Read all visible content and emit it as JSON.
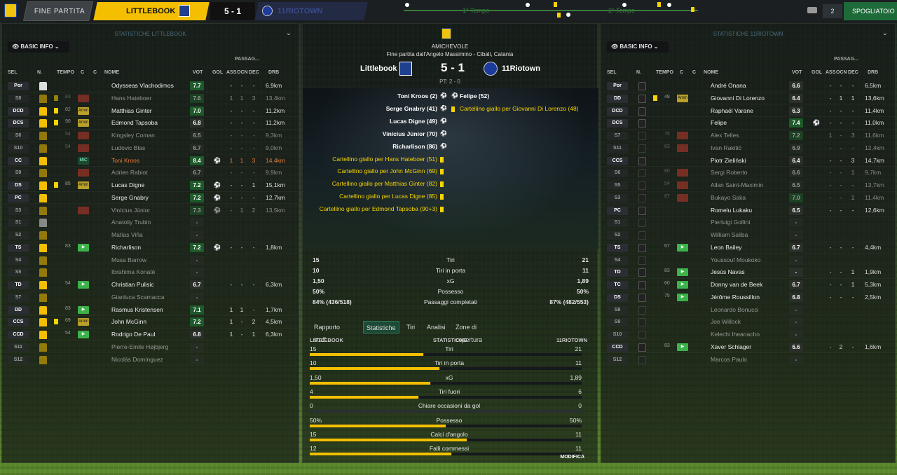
{
  "topbar": {
    "fine": "FINE PARTITA",
    "home": "LITTLEBOOK",
    "score": "5 - 1",
    "away": "11RIOTOWN",
    "tempo1": "1° Tempo",
    "tempo2": "2° Tempo",
    "users": "2",
    "spogliatoio": "SPOGLIATOIO"
  },
  "left": {
    "title": "STATISTICHE LITTLEBOOK",
    "basic": "BASIC INFO",
    "passag": "PASSAG...",
    "headers": [
      "SEL",
      "N.",
      "TEMPO",
      "C",
      "C",
      "NOME",
      "VOT",
      "GOL",
      "ASS",
      "OCN",
      "DEC",
      "DRB"
    ],
    "rows": [
      {
        "pos": "Por",
        "shirt": "w",
        "yc": false,
        "min": "",
        "pm": "",
        "name": "Odysseas Vlachodimos",
        "vot": "7.7",
        "gol": "",
        "ass": "-",
        "ocn": "-",
        "dec": "-",
        "drb": "6,9km",
        "dim": false
      },
      {
        "pos": "S8",
        "shirt": "y",
        "yc": true,
        "min": "83",
        "pm": "red",
        "pmt": "",
        "name": "Hans Hateboer",
        "vot": "7.6",
        "gol": "",
        "ass": "1",
        "ocn": "1",
        "dec": "3",
        "drb": "13,4km",
        "dim": true
      },
      {
        "pos": "DCD",
        "shirt": "y",
        "yc": true,
        "min": "82",
        "pm": "amm",
        "pmt": "Amm",
        "name": "Matthias Ginter",
        "vot": "7.0",
        "gol": "",
        "ass": "-",
        "ocn": "-",
        "dec": "-",
        "drb": "11,2km",
        "dim": false
      },
      {
        "pos": "DCS",
        "shirt": "y",
        "yc": true,
        "min": "90",
        "pm": "amm",
        "pmt": "Amm",
        "name": "Edmond Tapsoba",
        "vot": "6.8",
        "gol": "",
        "ass": "-",
        "ocn": "-",
        "dec": "-",
        "drb": "11,2km",
        "dim": false
      },
      {
        "pos": "S6",
        "shirt": "y",
        "yc": false,
        "min": "54",
        "pm": "red",
        "pmt": "",
        "name": "Kingsley Coman",
        "vot": "6.5",
        "gol": "",
        "ass": "-",
        "ocn": "-",
        "dec": "-",
        "drb": "9,3km",
        "dim": true
      },
      {
        "pos": "S10",
        "shirt": "y",
        "yc": false,
        "min": "54",
        "pm": "red",
        "pmt": "",
        "name": "Ludovic Blas",
        "vot": "6.7",
        "gol": "",
        "ass": "-",
        "ocn": "-",
        "dec": "-",
        "drb": "9,0km",
        "dim": true
      },
      {
        "pos": "CC",
        "shirt": "y",
        "yc": false,
        "min": "",
        "pm": "mic",
        "pmt": "MiC",
        "name": "Toni Kroos",
        "vot": "8.4",
        "gol": "⚽",
        "ass": "1",
        "ocn": "1",
        "dec": "3",
        "drb": "14,4km",
        "dim": false,
        "hl": true
      },
      {
        "pos": "S9",
        "shirt": "y",
        "yc": false,
        "min": "",
        "pm": "red",
        "pmt": "",
        "name": "Adrien Rabiot",
        "vot": "6.7",
        "gol": "",
        "ass": "-",
        "ocn": "-",
        "dec": "-",
        "drb": "9,9km",
        "dim": true
      },
      {
        "pos": "DS",
        "shirt": "y",
        "yc": true,
        "min": "85",
        "pm": "amm",
        "pmt": "Amm",
        "name": "Lucas Digne",
        "vot": "7.2",
        "gol": "⚽",
        "ass": "-",
        "ocn": "-",
        "dec": "1",
        "drb": "15,1km",
        "dim": false
      },
      {
        "pos": "PC",
        "shirt": "y",
        "yc": false,
        "min": "",
        "pm": "",
        "pmt": "",
        "name": "Serge Gnabry",
        "vot": "7.2",
        "gol": "⚽",
        "ass": "-",
        "ocn": "-",
        "dec": "-",
        "drb": "12,7km",
        "dim": false
      },
      {
        "pos": "S3",
        "shirt": "y",
        "yc": false,
        "min": "",
        "pm": "red",
        "pmt": "",
        "name": "Vinícius Júnior",
        "vot": "7.3",
        "gol": "⚽",
        "ass": "-",
        "ocn": "1",
        "dec": "2",
        "drb": "13,5km",
        "dim": true
      },
      {
        "pos": "S1",
        "shirt": "w",
        "yc": false,
        "min": "",
        "pm": "",
        "pmt": "",
        "name": "Anatoliy Trubin",
        "vot": "-",
        "gol": "",
        "ass": "",
        "ocn": "",
        "dec": "",
        "drb": "",
        "dim": true
      },
      {
        "pos": "S2",
        "shirt": "y",
        "yc": false,
        "min": "",
        "pm": "",
        "pmt": "",
        "name": "Matías Viña",
        "vot": "-",
        "gol": "",
        "ass": "",
        "ocn": "",
        "dec": "",
        "drb": "",
        "dim": true
      },
      {
        "pos": "TS",
        "shirt": "y",
        "yc": false,
        "min": "83",
        "pm": "grn",
        "pmt": "▶",
        "name": "Richarlison",
        "vot": "7.2",
        "gol": "⚽",
        "ass": "-",
        "ocn": "-",
        "dec": "-",
        "drb": "1,8km",
        "dim": false
      },
      {
        "pos": "S4",
        "shirt": "y",
        "yc": false,
        "min": "",
        "pm": "",
        "pmt": "",
        "name": "Musa Barrow",
        "vot": "-",
        "gol": "",
        "ass": "",
        "ocn": "",
        "dec": "",
        "drb": "",
        "dim": true
      },
      {
        "pos": "S5",
        "shirt": "y",
        "yc": false,
        "min": "",
        "pm": "",
        "pmt": "",
        "name": "Ibrahima Konaté",
        "vot": "-",
        "gol": "",
        "ass": "",
        "ocn": "",
        "dec": "",
        "drb": "",
        "dim": true
      },
      {
        "pos": "TD",
        "shirt": "y",
        "yc": false,
        "min": "54",
        "pm": "grn",
        "pmt": "▶",
        "name": "Christian Pulisic",
        "vot": "6.7",
        "gol": "",
        "ass": "-",
        "ocn": "-",
        "dec": "-",
        "drb": "6,3km",
        "dim": false
      },
      {
        "pos": "S7",
        "shirt": "y",
        "yc": false,
        "min": "",
        "pm": "",
        "pmt": "",
        "name": "Gianluca Scamacca",
        "vot": "-",
        "gol": "",
        "ass": "",
        "ocn": "",
        "dec": "",
        "drb": "",
        "dim": true
      },
      {
        "pos": "DD",
        "shirt": "y",
        "yc": false,
        "min": "83",
        "pm": "grn",
        "pmt": "▶",
        "name": "Rasmus Kristensen",
        "vot": "7.1",
        "gol": "",
        "ass": "1",
        "ocn": "1",
        "dec": "-",
        "drb": "1,7km",
        "dim": false
      },
      {
        "pos": "CCS",
        "shirt": "y",
        "yc": true,
        "min": "69",
        "pm": "amm",
        "pmt": "Amm",
        "name": "John McGinn",
        "vot": "7.2",
        "gol": "",
        "ass": "1",
        "ocn": "-",
        "dec": "2",
        "drb": "4,5km",
        "dim": false
      },
      {
        "pos": "CCD",
        "shirt": "y",
        "yc": false,
        "min": "54",
        "pm": "grn",
        "pmt": "▶",
        "name": "Rodrigo De Paul",
        "vot": "6.8",
        "gol": "",
        "ass": "1",
        "ocn": "-",
        "dec": "1",
        "drb": "6,3km",
        "dim": false
      },
      {
        "pos": "S11",
        "shirt": "y",
        "yc": false,
        "min": "",
        "pm": "",
        "pmt": "",
        "name": "Pierre-Emile Højbjerg",
        "vot": "-",
        "gol": "",
        "ass": "",
        "ocn": "",
        "dec": "",
        "drb": "",
        "dim": true
      },
      {
        "pos": "S12",
        "shirt": "y",
        "yc": false,
        "min": "",
        "pm": "",
        "pmt": "",
        "name": "Nicolás Domínguez",
        "vot": "-",
        "gol": "",
        "ass": "",
        "ocn": "",
        "dec": "",
        "drb": "",
        "dim": true
      }
    ]
  },
  "right": {
    "title": "STATISTICHE 11RIOTOWN",
    "basic": "BASIC INFO",
    "passag": "PASSAG...",
    "headers": [
      "SEL",
      "N.",
      "TEMPO",
      "C",
      "C",
      "NOME",
      "VOT",
      "GOL",
      "ASS",
      "OCN",
      "DEC",
      "DRB"
    ],
    "rows": [
      {
        "pos": "Por",
        "yc": false,
        "min": "",
        "pm": "",
        "pmt": "",
        "name": "André Onana",
        "vot": "6.6",
        "gol": "",
        "ass": "-",
        "ocn": "-",
        "dec": "-",
        "drb": "6,5km",
        "dim": false
      },
      {
        "pos": "DD",
        "yc": true,
        "min": "48",
        "pm": "amm",
        "pmt": "Amm",
        "name": "Giovanni Di Lorenzo",
        "vot": "6.4",
        "gol": "",
        "ass": "-",
        "ocn": "1",
        "dec": "1",
        "drb": "13,6km",
        "dim": false
      },
      {
        "pos": "DCD",
        "yc": false,
        "min": "",
        "pm": "",
        "pmt": "",
        "name": "Raphaël Varane",
        "vot": "6.3",
        "gol": "",
        "ass": "-",
        "ocn": "-",
        "dec": "-",
        "drb": "11,4km",
        "dim": false
      },
      {
        "pos": "DCS",
        "yc": false,
        "min": "",
        "pm": "",
        "pmt": "",
        "name": "Felipe",
        "vot": "7.4",
        "gol": "⚽",
        "ass": "-",
        "ocn": "-",
        "dec": "-",
        "drb": "11,0km",
        "dim": false
      },
      {
        "pos": "S7",
        "yc": false,
        "min": "75",
        "pm": "red",
        "pmt": "",
        "name": "Alex Telles",
        "vot": "7.2",
        "gol": "",
        "ass": "1",
        "ocn": "-",
        "dec": "3",
        "drb": "11,6km",
        "dim": true
      },
      {
        "pos": "S11",
        "yc": false,
        "min": "83",
        "pm": "red",
        "pmt": "",
        "name": "Ivan Rakitić",
        "vot": "6.9",
        "gol": "",
        "ass": "-",
        "ocn": "-",
        "dec": "-",
        "drb": "12,4km",
        "dim": true
      },
      {
        "pos": "CCS",
        "yc": false,
        "min": "",
        "pm": "",
        "pmt": "",
        "name": "Piotr Zieliński",
        "vot": "6.4",
        "gol": "",
        "ass": "-",
        "ocn": "-",
        "dec": "3",
        "drb": "14,7km",
        "dim": false
      },
      {
        "pos": "S6",
        "yc": false,
        "min": "60",
        "pm": "red",
        "pmt": "",
        "name": "Sergi Roberto",
        "vot": "6.6",
        "gol": "",
        "ass": "-",
        "ocn": "-",
        "dec": "1",
        "drb": "9,7km",
        "dim": true
      },
      {
        "pos": "S5",
        "yc": false,
        "min": "54",
        "pm": "red",
        "pmt": "",
        "name": "Allan Saint-Maximin",
        "vot": "6.5",
        "gol": "",
        "ass": "-",
        "ocn": "-",
        "dec": "-",
        "drb": "13,7km",
        "dim": true
      },
      {
        "pos": "S3",
        "yc": false,
        "min": "67",
        "pm": "red",
        "pmt": "",
        "name": "Bukayo Saka",
        "vot": "7.0",
        "gol": "",
        "ass": "-",
        "ocn": "-",
        "dec": "1",
        "drb": "11,4km",
        "dim": true
      },
      {
        "pos": "PC",
        "yc": false,
        "min": "",
        "pm": "",
        "pmt": "",
        "name": "Romelu Lukaku",
        "vot": "6.5",
        "gol": "",
        "ass": "-",
        "ocn": "-",
        "dec": "-",
        "drb": "12,6km",
        "dim": false
      },
      {
        "pos": "S1",
        "yc": false,
        "min": "",
        "pm": "",
        "pmt": "",
        "name": "Pierluigi Gollini",
        "vot": "-",
        "gol": "",
        "ass": "",
        "ocn": "",
        "dec": "",
        "drb": "",
        "dim": true
      },
      {
        "pos": "S2",
        "yc": false,
        "min": "",
        "pm": "",
        "pmt": "",
        "name": "William Saliba",
        "vot": "-",
        "gol": "",
        "ass": "",
        "ocn": "",
        "dec": "",
        "drb": "",
        "dim": true
      },
      {
        "pos": "TS",
        "yc": false,
        "min": "67",
        "pm": "grn",
        "pmt": "▶",
        "name": "Leon Bailey",
        "vot": "6.7",
        "gol": "",
        "ass": "-",
        "ocn": "-",
        "dec": "-",
        "drb": "4,4km",
        "dim": false
      },
      {
        "pos": "S4",
        "yc": false,
        "min": "",
        "pm": "",
        "pmt": "",
        "name": "Youssouf Moukoko",
        "vot": "-",
        "gol": "",
        "ass": "",
        "ocn": "",
        "dec": "",
        "drb": "",
        "dim": true
      },
      {
        "pos": "TD",
        "yc": false,
        "min": "83",
        "pm": "grn",
        "pmt": "▶",
        "name": "Jesús Navas",
        "vot": "-",
        "gol": "",
        "ass": "-",
        "ocn": "-",
        "dec": "1",
        "drb": "1,9km",
        "dim": false
      },
      {
        "pos": "TC",
        "yc": false,
        "min": "60",
        "pm": "grn",
        "pmt": "▶",
        "name": "Donny van de Beek",
        "vot": "6.7",
        "gol": "",
        "ass": "-",
        "ocn": "-",
        "dec": "1",
        "drb": "5,3km",
        "dim": false
      },
      {
        "pos": "DS",
        "yc": false,
        "min": "75",
        "pm": "grn",
        "pmt": "▶",
        "name": "Jérôme Roussillon",
        "vot": "6.8",
        "gol": "",
        "ass": "-",
        "ocn": "-",
        "dec": "-",
        "drb": "2,5km",
        "dim": false
      },
      {
        "pos": "S8",
        "yc": false,
        "min": "",
        "pm": "",
        "pmt": "",
        "name": "Leonardo Bonucci",
        "vot": "-",
        "gol": "",
        "ass": "",
        "ocn": "",
        "dec": "",
        "drb": "",
        "dim": true
      },
      {
        "pos": "S9",
        "yc": false,
        "min": "",
        "pm": "",
        "pmt": "",
        "name": "Joe Willock",
        "vot": "-",
        "gol": "",
        "ass": "",
        "ocn": "",
        "dec": "",
        "drb": "",
        "dim": true
      },
      {
        "pos": "S10",
        "yc": false,
        "min": "",
        "pm": "",
        "pmt": "",
        "name": "Kelechi Iheanacho",
        "vot": "-",
        "gol": "",
        "ass": "",
        "ocn": "",
        "dec": "",
        "drb": "",
        "dim": true
      },
      {
        "pos": "CCD",
        "yc": false,
        "min": "83",
        "pm": "grn",
        "pmt": "▶",
        "name": "Xaver Schlager",
        "vot": "6.6",
        "gol": "",
        "ass": "-",
        "ocn": "2",
        "dec": "-",
        "drb": "1,6km",
        "dim": false
      },
      {
        "pos": "S12",
        "yc": false,
        "min": "",
        "pm": "",
        "pmt": "",
        "name": "Marcos Paulo",
        "vot": "-",
        "gol": "",
        "ass": "",
        "ocn": "",
        "dec": "",
        "drb": "",
        "dim": true
      }
    ]
  },
  "center": {
    "comp": "AMICHEVOLE",
    "venue": "Fine partita dall'Angelo Massimino - Cibali, Catania",
    "home": "Littlebook",
    "away": "11Riotown",
    "score": "5 - 1",
    "pt": "PT: 2 - 0",
    "home_events": [
      "Toni Kroos (2)",
      "Serge Gnabry (41)",
      "Lucas Digne (49)",
      "Vinícius Júnior (70)",
      "Richarlison (86)",
      "Cartellino giallo per Hans Hateboer (51)",
      "Cartellino giallo per John McGinn (69)",
      "Cartellino giallo per Matthias Ginter (82)",
      "Cartellino giallo per Lucas Digne (85)",
      "Cartellino giallo per Edmond Tapsoba (90+3)"
    ],
    "away_events": [
      "Felipe (52)",
      "Cartellino giallo per Giovanni Di Lorenzo (48)"
    ],
    "summary": [
      [
        "15",
        "Tiri",
        "21"
      ],
      [
        "10",
        "Tiri in porta",
        "11"
      ],
      [
        "1,50",
        "xG",
        "1,89"
      ],
      [
        "50%",
        "Possesso",
        "50%"
      ],
      [
        "84% (436/518)",
        "Passaggi completati",
        "87% (482/553)"
      ]
    ],
    "tabs": [
      "Rapporto staff",
      "Statistiche",
      "Tiri",
      "Analisi",
      "Zone di copertura"
    ],
    "bars_head": [
      "LITTLEBOOK",
      "STATISTICHE",
      "11RIOTOWN"
    ],
    "bars": [
      {
        "h": "15",
        "l": "Tiri",
        "a": "21",
        "hv": 15,
        "av": 21
      },
      {
        "h": "10",
        "l": "Tiri in porta",
        "a": "11",
        "hv": 10,
        "av": 11
      },
      {
        "h": "1,50",
        "l": "xG",
        "a": "1,89",
        "hv": 1.5,
        "av": 1.89
      },
      {
        "h": "4",
        "l": "Tiri fuori",
        "a": "6",
        "hv": 4,
        "av": 6
      },
      {
        "h": "0",
        "l": "Chiare occasioni da gol",
        "a": "0",
        "hv": 0,
        "av": 0
      },
      {
        "h": "50%",
        "l": "Possesso",
        "a": "50%",
        "hv": 50,
        "av": 50
      },
      {
        "h": "15",
        "l": "Calci d'angolo",
        "a": "11",
        "hv": 15,
        "av": 11
      },
      {
        "h": "12",
        "l": "Falli commessi",
        "a": "11",
        "hv": 12,
        "av": 11
      }
    ],
    "modifica": "MODIFICA"
  },
  "colors": {
    "yellow": "#f4bf00",
    "green": "#3cb34a",
    "red": "#c0392b"
  }
}
